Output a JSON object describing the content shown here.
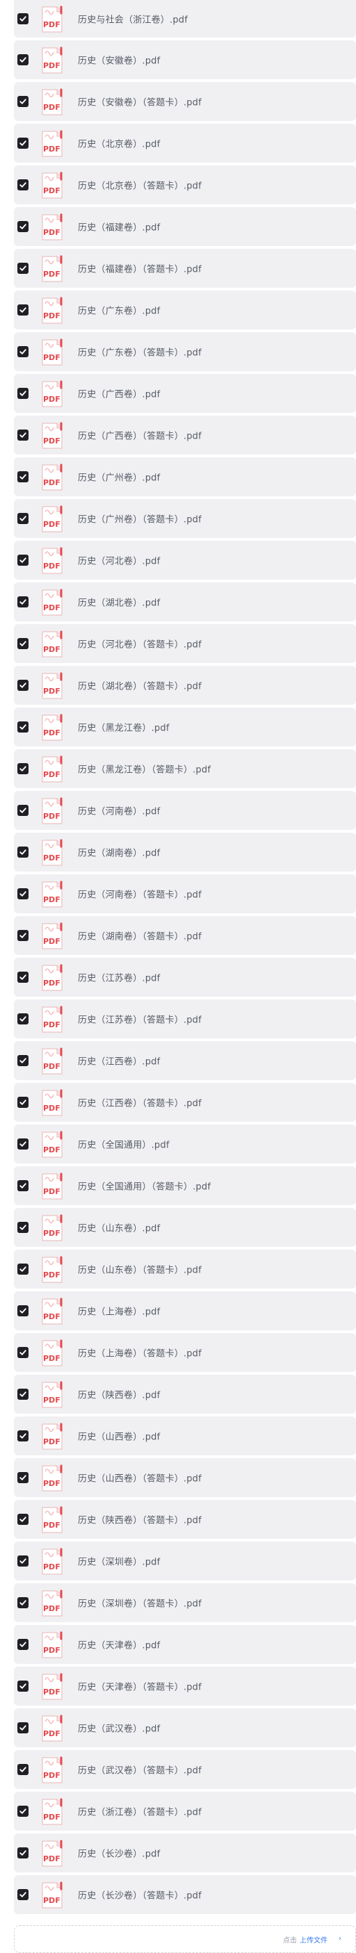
{
  "file_list": {
    "files": [
      {
        "name": "历史与社会（浙江卷）.pdf",
        "checked": true
      },
      {
        "name": "历史（安徽卷）.pdf",
        "checked": true
      },
      {
        "name": "历史（安徽卷）（答题卡）.pdf",
        "checked": true
      },
      {
        "name": "历史（北京卷）.pdf",
        "checked": true
      },
      {
        "name": "历史（北京卷）（答题卡）.pdf",
        "checked": true
      },
      {
        "name": "历史（福建卷）.pdf",
        "checked": true
      },
      {
        "name": "历史（福建卷）（答题卡）.pdf",
        "checked": true
      },
      {
        "name": "历史（广东卷）.pdf",
        "checked": true
      },
      {
        "name": "历史（广东卷）（答题卡）.pdf",
        "checked": true
      },
      {
        "name": "历史（广西卷）.pdf",
        "checked": true
      },
      {
        "name": "历史（广西卷）（答题卡）.pdf",
        "checked": true
      },
      {
        "name": "历史（广州卷）.pdf",
        "checked": true
      },
      {
        "name": "历史（广州卷）（答题卡）.pdf",
        "checked": true
      },
      {
        "name": "历史（河北卷）.pdf",
        "checked": true
      },
      {
        "name": "历史（湖北卷）.pdf",
        "checked": true
      },
      {
        "name": "历史（河北卷）（答题卡）.pdf",
        "checked": true
      },
      {
        "name": "历史（湖北卷）（答题卡）.pdf",
        "checked": true
      },
      {
        "name": "历史（黑龙江卷）.pdf",
        "checked": true
      },
      {
        "name": "历史（黑龙江卷）（答题卡）.pdf",
        "checked": true
      },
      {
        "name": "历史（河南卷）.pdf",
        "checked": true
      },
      {
        "name": "历史（湖南卷）.pdf",
        "checked": true
      },
      {
        "name": "历史（河南卷）（答题卡）.pdf",
        "checked": true
      },
      {
        "name": "历史（湖南卷）（答题卡）.pdf",
        "checked": true
      },
      {
        "name": "历史（江苏卷）.pdf",
        "checked": true
      },
      {
        "name": "历史（江苏卷）（答题卡）.pdf",
        "checked": true
      },
      {
        "name": "历史（江西卷）.pdf",
        "checked": true
      },
      {
        "name": "历史（江西卷）（答题卡）.pdf",
        "checked": true
      },
      {
        "name": "历史（全国通用）.pdf",
        "checked": true
      },
      {
        "name": "历史（全国通用）（答题卡）.pdf",
        "checked": true
      },
      {
        "name": "历史（山东卷）.pdf",
        "checked": true
      },
      {
        "name": "历史（山东卷）（答题卡）.pdf",
        "checked": true
      },
      {
        "name": "历史（上海卷）.pdf",
        "checked": true
      },
      {
        "name": "历史（上海卷）（答题卡）.pdf",
        "checked": true
      },
      {
        "name": "历史（陕西卷）.pdf",
        "checked": true
      },
      {
        "name": "历史（山西卷）.pdf",
        "checked": true
      },
      {
        "name": "历史（山西卷）（答题卡）.pdf",
        "checked": true
      },
      {
        "name": "历史（陕西卷）（答题卡）.pdf",
        "checked": true
      },
      {
        "name": "历史（深圳卷）.pdf",
        "checked": true
      },
      {
        "name": "历史（深圳卷）（答题卡）.pdf",
        "checked": true
      },
      {
        "name": "历史（天津卷）.pdf",
        "checked": true
      },
      {
        "name": "历史（天津卷）（答题卡）.pdf",
        "checked": true
      },
      {
        "name": "历史（武汉卷）.pdf",
        "checked": true
      },
      {
        "name": "历史（武汉卷）（答题卡）.pdf",
        "checked": true
      },
      {
        "name": "历史（浙江卷）（答题卡）.pdf",
        "checked": true
      },
      {
        "name": "历史（长沙卷）.pdf",
        "checked": true
      },
      {
        "name": "历史（长沙卷）（答题卡）.pdf",
        "checked": true
      }
    ],
    "file_icon_label": "PDF",
    "checkbox_icon": "check-icon",
    "file_icon": "pdf-file-icon"
  },
  "upload": {
    "hint": "点击",
    "link_label": "上传文件",
    "chevron": "›"
  },
  "colors": {
    "row_background": "#f0f0f2",
    "checkbox_fill": "#1f1f24",
    "pdf_red": "#e5484d",
    "text": "#555a66",
    "link": "#3b7cf0"
  }
}
